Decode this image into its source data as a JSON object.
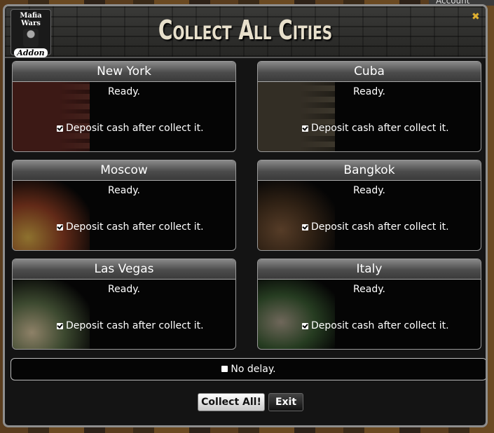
{
  "header": {
    "title": "Collect All Cities",
    "logo_top": "Mafia Wars",
    "logo_bottom": "Addon",
    "close_icon": "close-x-icon",
    "accent": "#e0b030"
  },
  "background": {
    "account_text": "Account"
  },
  "cities": [
    {
      "name": "New York",
      "status": "Ready.",
      "deposit_label": "Deposit cash after collect it.",
      "deposit_checked": true
    },
    {
      "name": "Cuba",
      "status": "Ready.",
      "deposit_label": "Deposit cash after collect it.",
      "deposit_checked": true
    },
    {
      "name": "Moscow",
      "status": "Ready.",
      "deposit_label": "Deposit cash after collect it.",
      "deposit_checked": true
    },
    {
      "name": "Bangkok",
      "status": "Ready.",
      "deposit_label": "Deposit cash after collect it.",
      "deposit_checked": true
    },
    {
      "name": "Las Vegas",
      "status": "Ready.",
      "deposit_label": "Deposit cash after collect it.",
      "deposit_checked": true
    },
    {
      "name": "Italy",
      "status": "Ready.",
      "deposit_label": "Deposit cash after collect it.",
      "deposit_checked": true
    }
  ],
  "options": {
    "no_delay_label": "No delay.",
    "no_delay_checked": false
  },
  "buttons": {
    "collect_all": "Collect All!",
    "exit": "Exit"
  }
}
